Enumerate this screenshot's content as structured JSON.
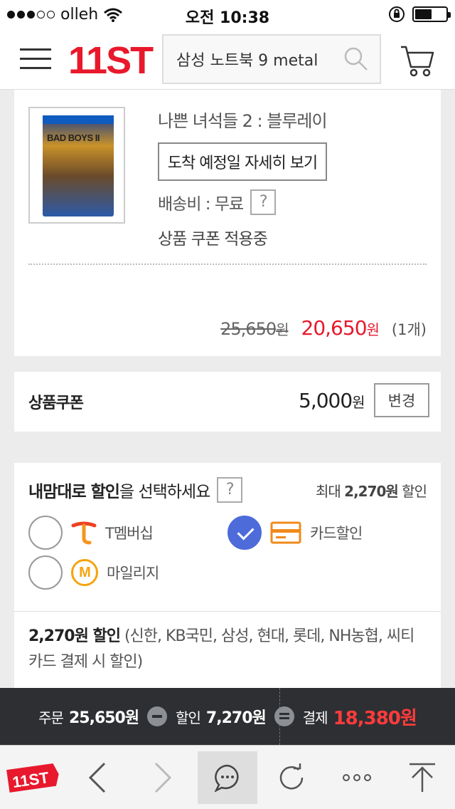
{
  "status_bar": {
    "carrier": "olleh",
    "time": "오전 10:38"
  },
  "header": {
    "logo": "11ST",
    "search_value": "삼성 노트북 9 metal"
  },
  "product": {
    "cover_text": "BAD BOYS II",
    "name": "나쁜 녀석들 2 : 블루레이",
    "arrival_button": "도착 예정일 자세히 보기",
    "shipping_label": "배송비 : 무료",
    "help": "?",
    "coupon_applied": "상품 쿠폰 적용중",
    "original_price": "25,650",
    "sale_price": "20,650",
    "currency": "원",
    "quantity": "(1개)"
  },
  "coupon": {
    "label": "상품쿠폰",
    "amount": "5,000",
    "currency": "원",
    "change_button": "변경"
  },
  "discount": {
    "title_bold": "내맘대로 할인",
    "title_rest": "을 선택하세요",
    "help": "?",
    "max_prefix": "최대 ",
    "max_value": "2,270원",
    "max_suffix": " 할인",
    "options": [
      {
        "label": "T멤버십",
        "selected": false
      },
      {
        "label": "카드할인",
        "selected": true
      },
      {
        "label": "마일리지",
        "selected": false
      }
    ],
    "mileage_icon_text": "M",
    "info_bold": "2,270원 할인",
    "info_rest": " (신한, KB국민, 삼성, 현대, 롯데, NH농협, 씨티카드 결제 시 할인)"
  },
  "summary": {
    "order_label": "주문",
    "order_value": "25,650원",
    "discount_label": "할인",
    "discount_value": "7,270원",
    "pay_label": "결제",
    "pay_value": "18,380원"
  },
  "bottom_nav": {
    "logo": "11ST"
  },
  "colors": {
    "brand": "#e8192c",
    "selected": "#4d6bd9",
    "card_icon": "#f08a1c",
    "mileage": "#f5a40e",
    "summary_bg": "#2d2f33"
  }
}
